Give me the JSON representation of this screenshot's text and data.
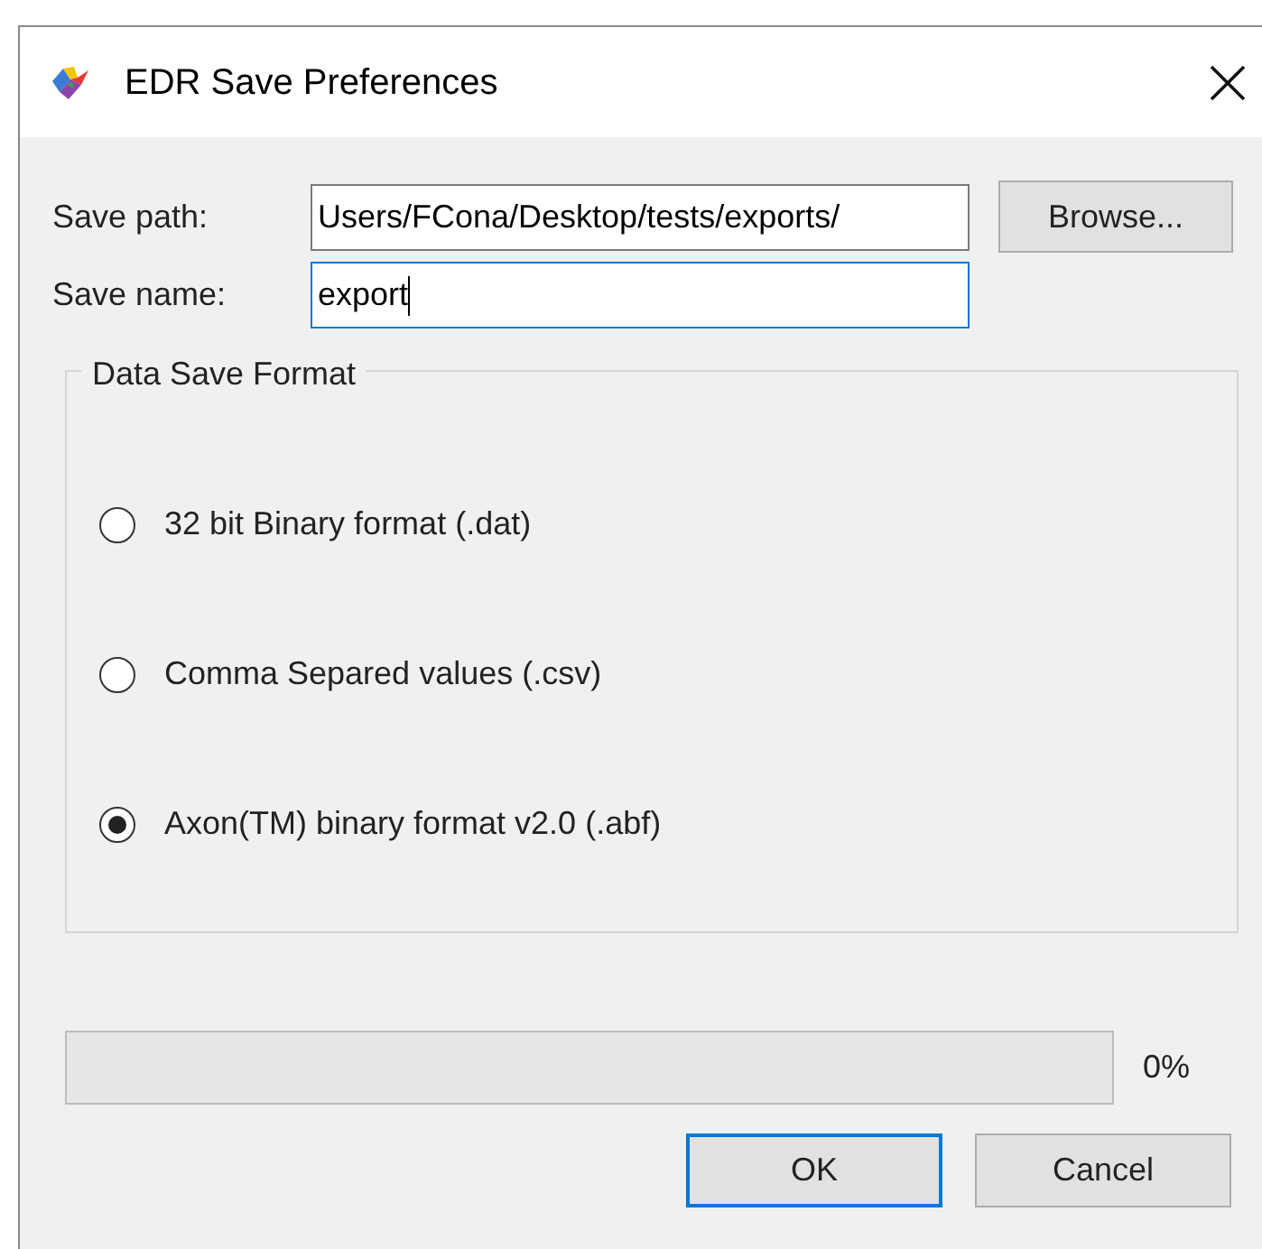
{
  "window": {
    "title": "EDR Save Preferences"
  },
  "fields": [
    {
      "label": "Save path:",
      "value": "Users/FCona/Desktop/tests/exports/",
      "focused": false
    },
    {
      "label": "Save name:",
      "value": "export",
      "focused": true
    }
  ],
  "browse_button": "Browse...",
  "format_group": {
    "title": "Data Save Format",
    "options": [
      {
        "label": "32 bit Binary format (.dat)",
        "selected": false
      },
      {
        "label": "Comma Separed values (.csv)",
        "selected": false
      },
      {
        "label": "Axon(TM) binary format v2.0 (.abf)",
        "selected": true
      }
    ]
  },
  "progress": {
    "level": 0,
    "reading": "0%"
  },
  "buttons": [
    {
      "label": "OK",
      "default": true
    },
    {
      "label": "Cancel",
      "default": false
    }
  ]
}
